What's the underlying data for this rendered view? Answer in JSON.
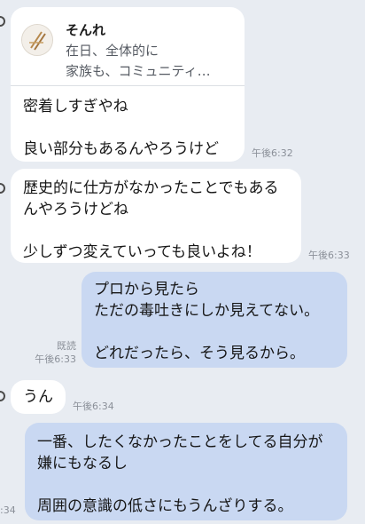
{
  "messages": [
    {
      "reply": {
        "name": "そんれ",
        "text": "在日、全体的に\n家族も、コミュニティ…"
      },
      "text": "密着しすぎやね\n\n良い部分もあるんやろうけど",
      "time": "午後6:32"
    },
    {
      "text": "歴史的に仕方がなかったことでもあるんやろうけどね\n\n少しずつ変えていっても良いよね！",
      "time": "午後6:33"
    },
    {
      "text": "プロから見たら\nただの毒吐きにしか見えてない。\n\nどれだったら、そう見るから。",
      "read": "既読",
      "time": "午後6:33"
    },
    {
      "text": "うん",
      "time": "午後6:34"
    },
    {
      "text": "一番、したくなかったことをしてる自分が嫌にもなるし\n\n周囲の意識の低さにもうんざりする。",
      "time_partial": ":34"
    }
  ]
}
